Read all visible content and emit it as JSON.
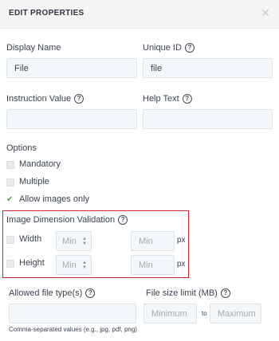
{
  "header": {
    "title": "EDIT PROPERTIES",
    "close_icon": "close-icon"
  },
  "display_name": {
    "label": "Display Name",
    "value": "File"
  },
  "unique_id": {
    "label": "Unique ID",
    "value": "file"
  },
  "instruction_value": {
    "label": "Instruction Value",
    "value": ""
  },
  "help_text": {
    "label": "Help Text",
    "value": ""
  },
  "help_glyph": "?",
  "options": {
    "heading": "Options",
    "items": [
      {
        "label": "Mandatory",
        "checked": false
      },
      {
        "label": "Multiple",
        "checked": false
      },
      {
        "label": "Allow images only",
        "checked": true
      }
    ]
  },
  "image_dimension": {
    "heading": "Image Dimension Validation",
    "rows": [
      {
        "label": "Width",
        "select": "Min",
        "input_placeholder": "Min",
        "unit": "px"
      },
      {
        "label": "Height",
        "select": "Min",
        "input_placeholder": "Min",
        "unit": "px"
      }
    ]
  },
  "allowed_types": {
    "label": "Allowed file type(s)",
    "value": "",
    "hint": "Comma-separated values (e.g., jpg, pdf, png)"
  },
  "file_size": {
    "label": "File size limit (MB)",
    "min_placeholder": "Minimum",
    "separator": "to",
    "max_placeholder": "Maximum"
  },
  "colors": {
    "accent_check": "#4aa84a",
    "highlight_border": "#d8232a",
    "field_bg": "#f3f7fa"
  }
}
